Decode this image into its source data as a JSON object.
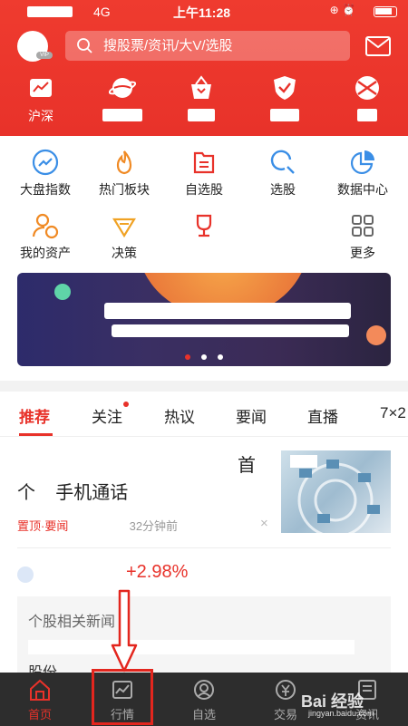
{
  "status_bar": {
    "network": "4G",
    "time": "上午11:28"
  },
  "header": {
    "search_placeholder": "搜股票/资讯/大V/选股",
    "avatar_badge": "VIP",
    "top_nav": [
      {
        "label": "沪深",
        "icon": "chart-trend-icon"
      },
      {
        "label": "",
        "icon": "planet-icon"
      },
      {
        "label": "",
        "icon": "basket-icon"
      },
      {
        "label": "",
        "icon": "shield-check-icon"
      },
      {
        "label": "",
        "icon": "globe-icon"
      }
    ]
  },
  "quick_grid": [
    {
      "label": "大盘指数",
      "icon": "index-trend-icon",
      "color": "#3a8ee6"
    },
    {
      "label": "热门板块",
      "icon": "flame-icon",
      "color": "#f08a24"
    },
    {
      "label": "自选股",
      "icon": "document-icon",
      "color": "#e8322a"
    },
    {
      "label": "选股",
      "icon": "magnifier-icon",
      "color": "#3a8ee6"
    },
    {
      "label": "数据中心",
      "icon": "pie-chart-icon",
      "color": "#3a8ee6"
    },
    {
      "label": "我的资产",
      "icon": "person-coin-icon",
      "color": "#f08a24"
    },
    {
      "label": "决策",
      "icon": "diamond-icon",
      "color": "#f0a224"
    },
    {
      "label": "",
      "icon": "trophy-icon",
      "color": "#e8322a"
    },
    {
      "label": "",
      "icon": "",
      "color": ""
    },
    {
      "label": "更多",
      "icon": "grid-more-icon",
      "color": "#666666"
    }
  ],
  "banner": {
    "page_count": 3,
    "active_page": 0
  },
  "feed_tabs": [
    {
      "label": "推荐",
      "active": true
    },
    {
      "label": "关注",
      "dot": true
    },
    {
      "label": "热议"
    },
    {
      "label": "要闻"
    },
    {
      "label": "直播"
    },
    {
      "label": "7×2"
    }
  ],
  "news": {
    "title_line1": "首",
    "title_line2": "个    手机通话",
    "tag": "置顶·要闻",
    "time_ago": "32分钟前",
    "close": "×"
  },
  "stock_row": {
    "change": "+2.98%"
  },
  "related": {
    "title": "个股相关新闻",
    "line2": "股份"
  },
  "tab_bar": [
    {
      "label": "首页",
      "icon": "home-icon",
      "active": true
    },
    {
      "label": "行情",
      "icon": "market-chart-icon"
    },
    {
      "label": "自选",
      "icon": "self-select-icon"
    },
    {
      "label": "交易",
      "icon": "trade-yen-icon"
    },
    {
      "label": "资讯",
      "icon": "news-icon"
    }
  ],
  "colors": {
    "brand_red": "#e8322a",
    "tabbar_bg": "#2d2d2d"
  },
  "watermark": {
    "brand": "Bai 经验",
    "url": "jingyan.baidu.com"
  }
}
